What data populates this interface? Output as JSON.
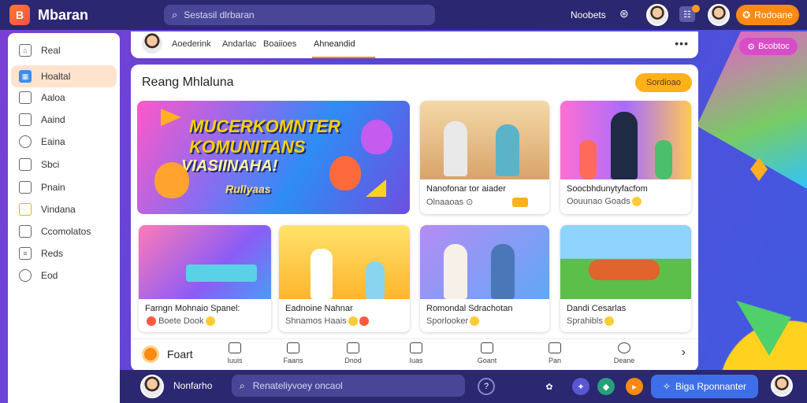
{
  "app": {
    "logo_letter": "B",
    "name": "Mbaran"
  },
  "search_top": {
    "placeholder": "Sestasil dlrbaran"
  },
  "topbar": {
    "link": "Noobets",
    "cta": "Rodoane"
  },
  "sidebar": {
    "items": [
      {
        "label": "Real",
        "icon": "home-icon"
      },
      {
        "label": "Hoaltal",
        "icon": "grid-icon",
        "active": true
      },
      {
        "label": "Aaloa",
        "icon": "folder-icon"
      },
      {
        "label": "Aaind",
        "icon": "bookmark-icon"
      },
      {
        "label": "Eaina",
        "icon": "search-icon"
      },
      {
        "label": "Sbci",
        "icon": "tag-icon"
      },
      {
        "label": "Pnain",
        "icon": "pin-icon"
      },
      {
        "label": "Vindana",
        "icon": "card-icon"
      },
      {
        "label": "Ccomolatos",
        "icon": "window-icon"
      },
      {
        "label": "Reds",
        "icon": "list-icon"
      },
      {
        "label": "Eod",
        "icon": "settings-icon"
      }
    ]
  },
  "tabs": [
    {
      "label": "Aoederink"
    },
    {
      "label": "Andarlac"
    },
    {
      "label": "Boaiioes"
    },
    {
      "label": "Ahneandid",
      "active": true
    }
  ],
  "panel": {
    "title": "Reang Mhlaluna",
    "button": "Sordioao"
  },
  "hero": {
    "lines": [
      "MUCERKOMNTER",
      "KOMUNITANS",
      "VIASIINAHA!",
      "Rullyaas"
    ]
  },
  "cards": [
    {
      "title": "Nanofonar tor aiader",
      "sub": "Olnaaoas ⊙"
    },
    {
      "title": "Soocbhdunytyfacfom",
      "sub": "Oouunao Goads"
    },
    {
      "title": "Farngn Mohnaio Spanel:",
      "sub": "Boete Dook"
    },
    {
      "title": "Eadnoine Nahnar",
      "sub": "Shnamos Haais"
    },
    {
      "title": "Romondal Sdrachotan",
      "sub": "Sporlooker"
    },
    {
      "title": "Dandi Cesarlas",
      "sub": "Sprahibls"
    }
  ],
  "iconbar": {
    "label": "Foart",
    "items": [
      "Iuuis",
      "Faans",
      "Dnod",
      "Iuas",
      "Goant",
      "Pan",
      "Deane"
    ]
  },
  "bottombar": {
    "name": "Nonfarho",
    "search_placeholder": "Renateliyvoey oncaol",
    "cta": "Biga Rponnanter"
  },
  "float_button": "Bcobtoc"
}
